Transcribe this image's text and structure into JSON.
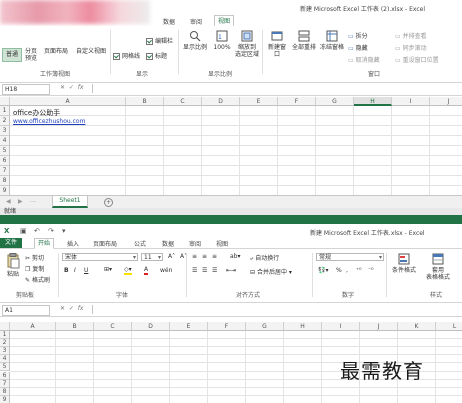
{
  "top_window": {
    "title": "新建 Microsoft Excel 工作表 (2).xlsx - Excel",
    "tabs": [
      "数据",
      "审阅",
      "视图"
    ],
    "active_tab": "视图",
    "ribbon": {
      "workbook_views": {
        "label": "工作簿视图",
        "normal": "普通",
        "page_break_l1": "分页",
        "page_break_l2": "预览",
        "page_layout": "页面布局",
        "custom_views": "自定义视图"
      },
      "show": {
        "label": "显示",
        "formula_bar_partial": "编辑栏",
        "gridlines": "网格线",
        "headings": "标题"
      },
      "zoom": {
        "label": "显示比例",
        "zoom": "显示比例",
        "zoom100": "100%",
        "zoom_sel_l1": "缩放到",
        "zoom_sel_l2": "选定区域"
      },
      "window": {
        "label": "窗口",
        "new_window": "新建窗口",
        "arrange_all": "全部重排",
        "freeze_panes": "冻结窗格",
        "split": "拆分",
        "hide": "隐藏",
        "unhide": "取消隐藏",
        "view_side": "并排查看",
        "sync_scroll": "同步滚动",
        "reset_pos": "重设窗口位置"
      }
    },
    "name_box": "H18",
    "fx": "fx",
    "columns": [
      "A",
      "B",
      "C",
      "D",
      "E",
      "F",
      "G",
      "H",
      "I",
      "J"
    ],
    "selected_column": "H",
    "rows": [
      "1",
      "2",
      "3",
      "4",
      "5",
      "6",
      "7",
      "8",
      "9",
      "10"
    ],
    "cells": {
      "A1": "office办公助手",
      "A2": "www.officezhushou.com"
    },
    "sheet_tab": "Sheet1",
    "add_sheet": "+"
  },
  "status_text": "就绪",
  "bottom_window": {
    "title": "新建 Microsoft Excel 工作表.xlsx - Excel",
    "file_tab": "文件",
    "tabs": [
      "开始",
      "插入",
      "页面布局",
      "公式",
      "数据",
      "审阅",
      "视图"
    ],
    "active_tab": "开始",
    "ribbon": {
      "clipboard": {
        "label": "剪贴板",
        "paste": "粘贴",
        "cut": "剪切",
        "copy": "复制",
        "format_painter": "格式刷"
      },
      "font": {
        "label": "字体",
        "font_name": "宋体",
        "font_size": "11",
        "grow": "A˄",
        "shrink": "A˅",
        "bold": "B",
        "italic": "I",
        "underline": "U",
        "font_color_glyph": "A",
        "wen": "wén"
      },
      "alignment": {
        "label": "对齐方式",
        "wrap_text": "自动换行",
        "merge_center": "合并后居中"
      },
      "number": {
        "label": "数字",
        "format": "常规",
        "percent": "%",
        "comma": ","
      },
      "styles": {
        "label": "样式",
        "conditional": "条件格式",
        "table_l1": "套用",
        "table_l2": "表格格式"
      }
    },
    "name_box": "A1",
    "fx": "fx",
    "columns": [
      "A",
      "B",
      "C",
      "D",
      "E",
      "F",
      "G",
      "H",
      "I",
      "J",
      "K",
      "L"
    ],
    "rows": [
      "1",
      "2",
      "3",
      "4",
      "5",
      "6",
      "7",
      "8",
      "9"
    ]
  },
  "watermark": "最需教育",
  "colors": {
    "excel_green": "#217346",
    "link_blue": "#1f3fbf"
  }
}
